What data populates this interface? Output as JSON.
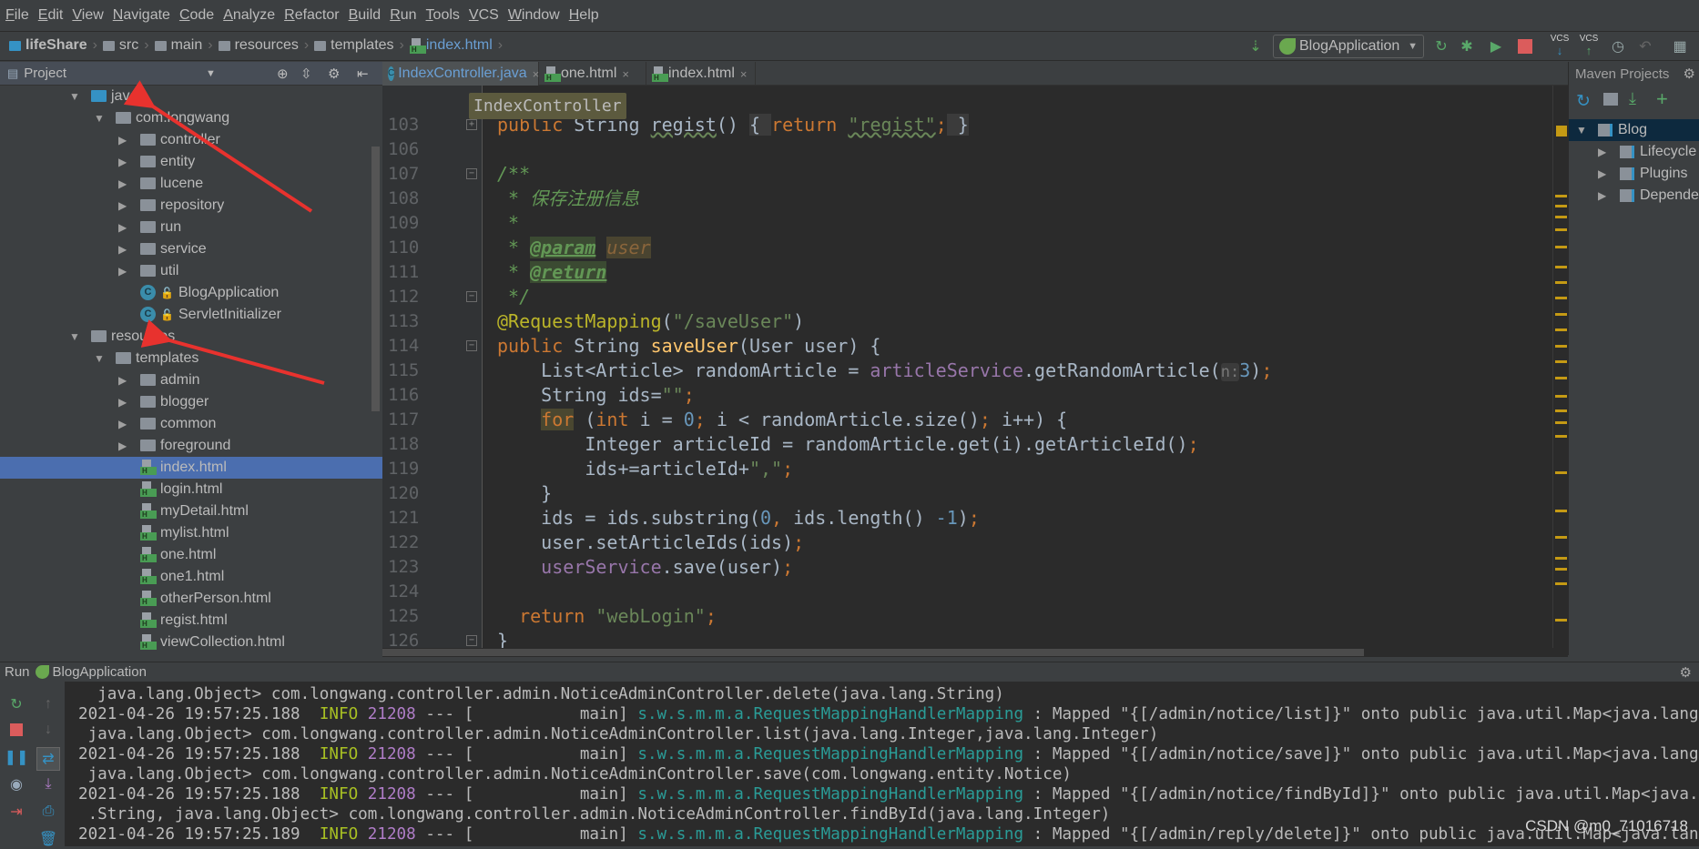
{
  "menu": [
    "File",
    "Edit",
    "View",
    "Navigate",
    "Code",
    "Analyze",
    "Refactor",
    "Build",
    "Run",
    "Tools",
    "VCS",
    "Window",
    "Help"
  ],
  "breadcrumb": [
    "lifeShare",
    "src",
    "main",
    "resources",
    "templates",
    "index.html"
  ],
  "toolbar": {
    "run_config": "BlogApplication",
    "icons": [
      "build-icon",
      "rerun-icon",
      "debug-icon",
      "coverage-icon",
      "stop-icon",
      "vcs-update-icon",
      "vcs-commit-icon",
      "history-icon",
      "revert-icon",
      "project-structure-icon"
    ],
    "vcs_label": "VCS"
  },
  "project_panel": {
    "title": "Project",
    "tree": [
      {
        "label": "java",
        "level": 0,
        "icon": "source-folder",
        "expanded": true
      },
      {
        "label": "com.longwang",
        "level": 1,
        "icon": "package",
        "expanded": true
      },
      {
        "label": "controller",
        "level": 2,
        "icon": "package",
        "expanded": false
      },
      {
        "label": "entity",
        "level": 2,
        "icon": "package",
        "expanded": false
      },
      {
        "label": "lucene",
        "level": 2,
        "icon": "package",
        "expanded": false
      },
      {
        "label": "repository",
        "level": 2,
        "icon": "package",
        "expanded": false
      },
      {
        "label": "run",
        "level": 2,
        "icon": "package",
        "expanded": false
      },
      {
        "label": "service",
        "level": 2,
        "icon": "package",
        "expanded": false
      },
      {
        "label": "util",
        "level": 2,
        "icon": "package",
        "expanded": false
      },
      {
        "label": "BlogApplication",
        "level": 2,
        "icon": "spring-boot-class"
      },
      {
        "label": "ServletInitializer",
        "level": 2,
        "icon": "class"
      },
      {
        "label": "resources",
        "level": 0,
        "icon": "resources-folder",
        "expanded": true
      },
      {
        "label": "templates",
        "level": 1,
        "icon": "package",
        "expanded": true
      },
      {
        "label": "admin",
        "level": 2,
        "icon": "package",
        "expanded": false
      },
      {
        "label": "blogger",
        "level": 2,
        "icon": "package",
        "expanded": false
      },
      {
        "label": "common",
        "level": 2,
        "icon": "package",
        "expanded": false
      },
      {
        "label": "foreground",
        "level": 2,
        "icon": "package",
        "expanded": false
      },
      {
        "label": "index.html",
        "level": 2,
        "icon": "html",
        "selected": true
      },
      {
        "label": "login.html",
        "level": 2,
        "icon": "html"
      },
      {
        "label": "myDetail.html",
        "level": 2,
        "icon": "html"
      },
      {
        "label": "mylist.html",
        "level": 2,
        "icon": "html"
      },
      {
        "label": "one.html",
        "level": 2,
        "icon": "html"
      },
      {
        "label": "one1.html",
        "level": 2,
        "icon": "html"
      },
      {
        "label": "otherPerson.html",
        "level": 2,
        "icon": "html"
      },
      {
        "label": "regist.html",
        "level": 2,
        "icon": "html"
      },
      {
        "label": "viewCollection.html",
        "level": 2,
        "icon": "html"
      }
    ]
  },
  "tabs": [
    {
      "label": "IndexController.java",
      "icon": "java-class",
      "active": true
    },
    {
      "label": "one.html",
      "icon": "html"
    },
    {
      "label": "index.html",
      "icon": "html"
    }
  ],
  "editor": {
    "structure_crumb": "IndexController",
    "lines": [
      {
        "n": "103",
        "fold": "+",
        "tokens": [
          {
            "t": "public ",
            "c": "kw"
          },
          {
            "t": "String "
          },
          {
            "t": "regist",
            "c": "warn"
          },
          {
            "t": "() "
          },
          {
            "t": "{ ",
            "c": "foldtxt"
          },
          {
            "t": "return ",
            "c": "kw"
          },
          {
            "t": "\"regist\"",
            "c": "str warn"
          },
          {
            "t": ";",
            "c": "kw"
          },
          {
            "t": " }",
            "c": "foldtxt"
          }
        ]
      },
      {
        "n": "106",
        "tokens": []
      },
      {
        "n": "107",
        "fold": "-",
        "tokens": [
          {
            "t": "/**",
            "c": "cmt"
          }
        ]
      },
      {
        "n": "108",
        "tokens": [
          {
            "t": " * 保存注册信息",
            "c": "cmt"
          }
        ]
      },
      {
        "n": "109",
        "tokens": [
          {
            "t": " *",
            "c": "cmt"
          }
        ]
      },
      {
        "n": "110",
        "tokens": [
          {
            "t": " * ",
            "c": "cmt"
          },
          {
            "t": "@param",
            "c": "tag"
          },
          {
            "t": " ",
            "c": "cmt"
          },
          {
            "t": "user",
            "c": "prm"
          }
        ]
      },
      {
        "n": "111",
        "tokens": [
          {
            "t": " * ",
            "c": "cmt"
          },
          {
            "t": "@return",
            "c": "tag"
          }
        ]
      },
      {
        "n": "112",
        "fold": "-",
        "tokens": [
          {
            "t": " */",
            "c": "cmt"
          }
        ]
      },
      {
        "n": "113",
        "tokens": [
          {
            "t": "@RequestMapping",
            "c": "ann"
          },
          {
            "t": "("
          },
          {
            "t": "\"/saveUser\"",
            "c": "str"
          },
          {
            "t": ")"
          }
        ]
      },
      {
        "n": "114",
        "fold": "-",
        "tokens": [
          {
            "t": "public ",
            "c": "kw"
          },
          {
            "t": "String "
          },
          {
            "t": "saveUser",
            "c": "decl"
          },
          {
            "t": "(User user) {"
          }
        ]
      },
      {
        "n": "115",
        "tokens": [
          {
            "t": "    List<Article> randomArticle = "
          },
          {
            "t": "articleService",
            "c": "fld"
          },
          {
            "t": ".getRandomArticle("
          },
          {
            "t": "n:",
            "c": "hint"
          },
          {
            "t": "3",
            "c": "num"
          },
          {
            "t": ")"
          },
          {
            "t": ";",
            "c": "kw"
          }
        ]
      },
      {
        "n": "116",
        "tokens": [
          {
            "t": "    String ids="
          },
          {
            "t": "\"\"",
            "c": "str"
          },
          {
            "t": ";",
            "c": "kw"
          }
        ]
      },
      {
        "n": "117",
        "tokens": [
          {
            "t": "    "
          },
          {
            "t": "for",
            "c": "kwhl"
          },
          {
            "t": " ("
          },
          {
            "t": "int ",
            "c": "kw"
          },
          {
            "t": "i = "
          },
          {
            "t": "0",
            "c": "num"
          },
          {
            "t": "; ",
            "c": "kw"
          },
          {
            "t": "i < randomArticle.size()"
          },
          {
            "t": "; ",
            "c": "kw"
          },
          {
            "t": "i++) {"
          }
        ]
      },
      {
        "n": "118",
        "tokens": [
          {
            "t": "        Integer articleId = randomArticle.get(i).getArticleId()"
          },
          {
            "t": ";",
            "c": "kw"
          }
        ]
      },
      {
        "n": "119",
        "tokens": [
          {
            "t": "        ids+=articleId+"
          },
          {
            "t": "\",\"",
            "c": "str"
          },
          {
            "t": ";",
            "c": "kw"
          }
        ]
      },
      {
        "n": "120",
        "tokens": [
          {
            "t": "    }"
          }
        ]
      },
      {
        "n": "121",
        "tokens": [
          {
            "t": "    ids = ids.substring("
          },
          {
            "t": "0",
            "c": "num"
          },
          {
            "t": ", ",
            "c": "kw"
          },
          {
            "t": "ids.length() "
          },
          {
            "t": "-1",
            "c": "num"
          },
          {
            "t": ")"
          },
          {
            "t": ";",
            "c": "kw"
          }
        ]
      },
      {
        "n": "122",
        "tokens": [
          {
            "t": "    user.setArticleIds(ids)"
          },
          {
            "t": ";",
            "c": "kw"
          }
        ]
      },
      {
        "n": "123",
        "tokens": [
          {
            "t": "    "
          },
          {
            "t": "userService",
            "c": "fld"
          },
          {
            "t": ".save(user)"
          },
          {
            "t": ";",
            "c": "kw"
          }
        ]
      },
      {
        "n": "124",
        "tokens": []
      },
      {
        "n": "125",
        "tokens": [
          {
            "t": "  "
          },
          {
            "t": "return ",
            "c": "kw"
          },
          {
            "t": "\"webLogin\"",
            "c": "str"
          },
          {
            "t": ";",
            "c": "kw"
          }
        ]
      },
      {
        "n": "126",
        "fold": "-",
        "tokens": [
          {
            "t": "}"
          }
        ]
      }
    ]
  },
  "maven_panel": {
    "title": "Maven Projects",
    "tree": [
      {
        "label": "Blog",
        "level": 0,
        "icon": "maven-module",
        "expanded": true,
        "selected": true
      },
      {
        "label": "Lifecycle",
        "level": 1,
        "icon": "lifecycle-folder"
      },
      {
        "label": "Plugins",
        "level": 1,
        "icon": "plugins-folder"
      },
      {
        "label": "Dependencies",
        "level": 1,
        "icon": "dependencies-folder"
      }
    ]
  },
  "run_panel": {
    "label": "Run",
    "config": "BlogApplication",
    "console": [
      {
        "type": "cont",
        "text": "  java.lang.Object> com.longwang.controller.admin.NoticeAdminController.delete(java.lang.String)"
      },
      {
        "type": "log",
        "ts": "2021-04-26 19:57:25.188",
        "level": "INFO",
        "pid": "21208",
        "mid": " --- [           main] ",
        "logger": "s.w.s.m.m.a.RequestMappingHandlerMapping",
        "msg": " : Mapped \"{[/admin/notice/list]}\" onto public java.util.Map<java.lang.String,"
      },
      {
        "type": "cont",
        "text": " java.lang.Object> com.longwang.controller.admin.NoticeAdminController.list(java.lang.Integer,java.lang.Integer)"
      },
      {
        "type": "log",
        "ts": "2021-04-26 19:57:25.188",
        "level": "INFO",
        "pid": "21208",
        "mid": " --- [           main] ",
        "logger": "s.w.s.m.m.a.RequestMappingHandlerMapping",
        "msg": " : Mapped \"{[/admin/notice/save]}\" onto public java.util.Map<java.lang.String,"
      },
      {
        "type": "cont",
        "text": " java.lang.Object> com.longwang.controller.admin.NoticeAdminController.save(com.longwang.entity.Notice)"
      },
      {
        "type": "log",
        "ts": "2021-04-26 19:57:25.188",
        "level": "INFO",
        "pid": "21208",
        "mid": " --- [           main] ",
        "logger": "s.w.s.m.m.a.RequestMappingHandlerMapping",
        "msg": " : Mapped \"{[/admin/notice/findById]}\" onto public java.util.Map<java.lang"
      },
      {
        "type": "cont",
        "text": " .String, java.lang.Object> com.longwang.controller.admin.NoticeAdminController.findById(java.lang.Integer)"
      },
      {
        "type": "log",
        "ts": "2021-04-26 19:57:25.189",
        "level": "INFO",
        "pid": "21208",
        "mid": " --- [           main] ",
        "logger": "s.w.s.m.m.a.RequestMappingHandlerMapping",
        "msg": " : Mapped \"{[/admin/reply/delete]}\" onto public java.util.Map<java.lang.String,"
      }
    ]
  },
  "watermark": "CSDN @m0_71016718",
  "colors": {
    "accent_selection": "#4b6eaf",
    "annotation_arrow": "#e8322e",
    "editor_bg": "#2b2b2b",
    "keyword": "#cc7832",
    "string": "#6a8759"
  }
}
